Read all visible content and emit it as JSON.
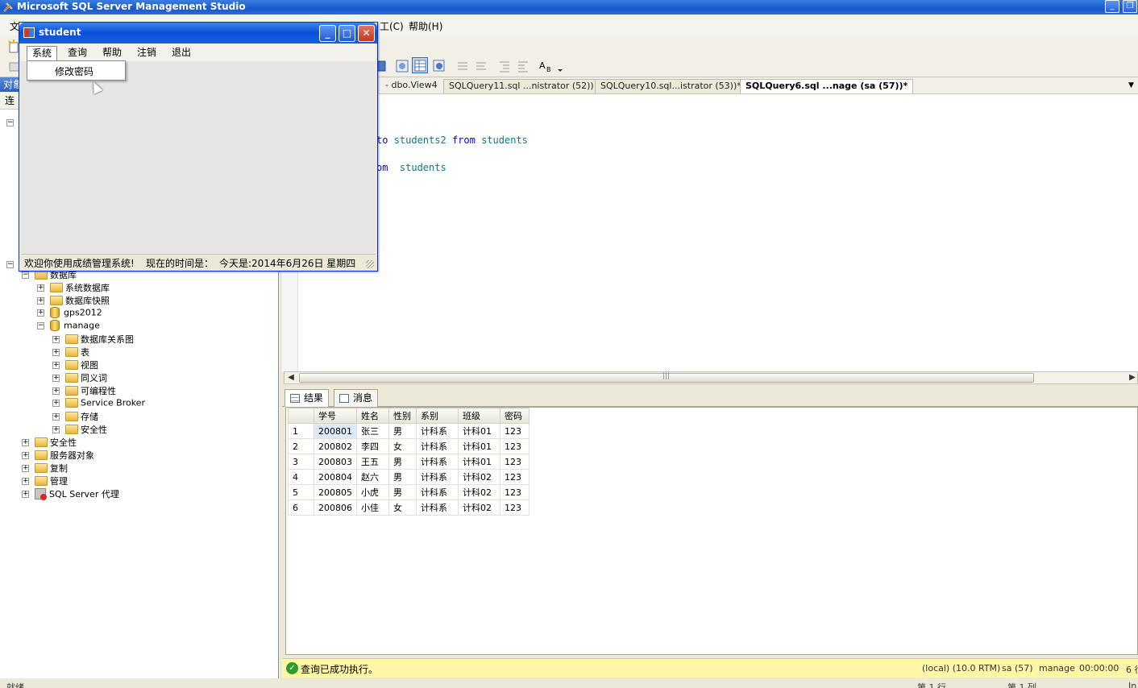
{
  "app": {
    "title": "Microsoft SQL Server Management Studio"
  },
  "menubar": {
    "file_partial": "文",
    "tools_partial": "工(C)",
    "help": "帮助(H)"
  },
  "object_explorer": {
    "header_partial": "对象",
    "connect_partial": "连",
    "tree": [
      {
        "label": "数据库",
        "indent": 1,
        "icon": "folder-icon",
        "expander": "−"
      },
      {
        "label": "系统数据库",
        "indent": 2,
        "icon": "folder-icon",
        "expander": "+"
      },
      {
        "label": "数据库快照",
        "indent": 2,
        "icon": "folder-icon",
        "expander": "+"
      },
      {
        "label": "gps2012",
        "indent": 2,
        "icon": "database-icon",
        "expander": "+"
      },
      {
        "label": "manage",
        "indent": 2,
        "icon": "database-icon",
        "expander": "−"
      },
      {
        "label": "数据库关系图",
        "indent": 3,
        "icon": "folder-icon",
        "expander": "+"
      },
      {
        "label": "表",
        "indent": 3,
        "icon": "folder-icon",
        "expander": "+"
      },
      {
        "label": "视图",
        "indent": 3,
        "icon": "folder-icon",
        "expander": "+"
      },
      {
        "label": "同义词",
        "indent": 3,
        "icon": "folder-icon",
        "expander": "+"
      },
      {
        "label": "可编程性",
        "indent": 3,
        "icon": "folder-icon",
        "expander": "+"
      },
      {
        "label": "Service Broker",
        "indent": 3,
        "icon": "folder-icon",
        "expander": "+"
      },
      {
        "label": "存储",
        "indent": 3,
        "icon": "folder-icon",
        "expander": "+"
      },
      {
        "label": "安全性",
        "indent": 3,
        "icon": "folder-icon",
        "expander": "+"
      },
      {
        "label": "安全性",
        "indent": 1,
        "icon": "folder-icon",
        "expander": "+"
      },
      {
        "label": "服务器对象",
        "indent": 1,
        "icon": "folder-icon",
        "expander": "+"
      },
      {
        "label": "复制",
        "indent": 1,
        "icon": "folder-icon",
        "expander": "+"
      },
      {
        "label": "管理",
        "indent": 1,
        "icon": "folder-icon",
        "expander": "+"
      },
      {
        "label": "SQL Server 代理",
        "indent": 1,
        "icon": "sql-agent-icon",
        "expander": "+"
      }
    ]
  },
  "editor": {
    "tabs": [
      {
        "label": "- dbo.View4",
        "active": false
      },
      {
        "label": "SQLQuery11.sql ...nistrator (52))",
        "active": false
      },
      {
        "label": "SQLQuery10.sql...istrator (53))*",
        "active": false
      },
      {
        "label": "SQLQuery6.sql ...nage (sa (57))*",
        "active": true
      }
    ],
    "code": {
      "line1_partial_kw": "to",
      "line1_table": "students2",
      "line1_from": "from",
      "line1_source": "students",
      "line2_partial_kw": "om",
      "line2_source": "students"
    }
  },
  "results": {
    "tabs": [
      {
        "label": "结果",
        "active": true
      },
      {
        "label": "消息",
        "active": false
      }
    ],
    "columns": [
      "学号",
      "姓名",
      "性别",
      "系别",
      "班级",
      "密码"
    ],
    "rows": [
      [
        "1",
        "200801",
        "张三",
        "男",
        "计科系",
        "计科01",
        "123"
      ],
      [
        "2",
        "200802",
        "李四",
        "女",
        "计科系",
        "计科01",
        "123"
      ],
      [
        "3",
        "200803",
        "王五",
        "男",
        "计科系",
        "计科01",
        "123"
      ],
      [
        "4",
        "200804",
        "赵六",
        "男",
        "计科系",
        "计科02",
        "123"
      ],
      [
        "5",
        "200805",
        "小虎",
        "男",
        "计科系",
        "计科02",
        "123"
      ],
      [
        "6",
        "200806",
        "小佳",
        "女",
        "计科系",
        "计科02",
        "123"
      ]
    ]
  },
  "query_status": {
    "message": "查询已成功执行。",
    "server": "(local) (10.0 RTM)",
    "user": "sa (57)",
    "database": "manage",
    "elapsed": "00:00:00",
    "rows_partial": "6 行"
  },
  "bottom_status": {
    "ready_partial": "就绪",
    "line": "第 1 行",
    "col": "第 1 列",
    "ins_partial": "In"
  },
  "student_window": {
    "title": "student",
    "menus": [
      "系统",
      "查询",
      "帮助",
      "注销",
      "退出"
    ],
    "dropdown_item": "修改密码",
    "status_welcome": "欢迎你使用成绩管理系统!",
    "status_time_label": "现在的时间是：",
    "status_date": "今天是:2014年6月26日 星期四"
  },
  "colors": {
    "xp_blue": "#0b4ed8",
    "status_yellow": "#fff6a8",
    "keyword_blue": "#0000ff",
    "identifier_teal": "#008080"
  }
}
